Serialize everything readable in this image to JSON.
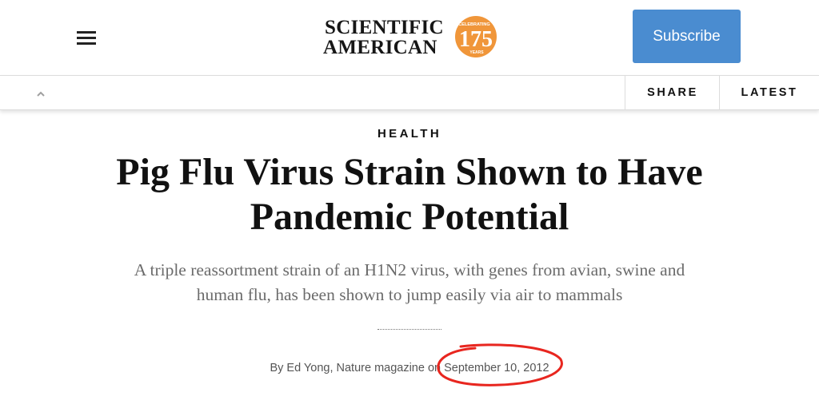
{
  "header": {
    "logo": {
      "line1": "SCIENTIFIC",
      "line2": "AMERICAN",
      "badge_top": "CELEBRATING",
      "badge_number": "175",
      "badge_bottom": "YEARS",
      "badge_color": "#f0963a"
    },
    "menu_icon": "hamburger-menu-icon",
    "subscribe_label": "Subscribe",
    "subscribe_color": "#4a8cd0"
  },
  "subnav": {
    "scroll_icon": "chevron-up-icon",
    "share_label": "SHARE",
    "latest_label": "LATEST"
  },
  "article": {
    "category": "HEALTH",
    "title_line1": "Pig Flu Virus Strain Shown to Have",
    "title_line2": "Pandemic Potential",
    "dek_line1": "A triple reassortment strain of an H1N2 virus, with genes from avian, swine and",
    "dek_line2": "human flu, has been shown to jump easily via air to mammals",
    "byline_prefix": "By ",
    "author": "Ed Yong",
    "publication_sep": ", ",
    "publication": "Nature magazine",
    "date_prefix": " on ",
    "date": "September 10, 2012"
  },
  "annotation": {
    "circle_color": "#e8261f"
  }
}
